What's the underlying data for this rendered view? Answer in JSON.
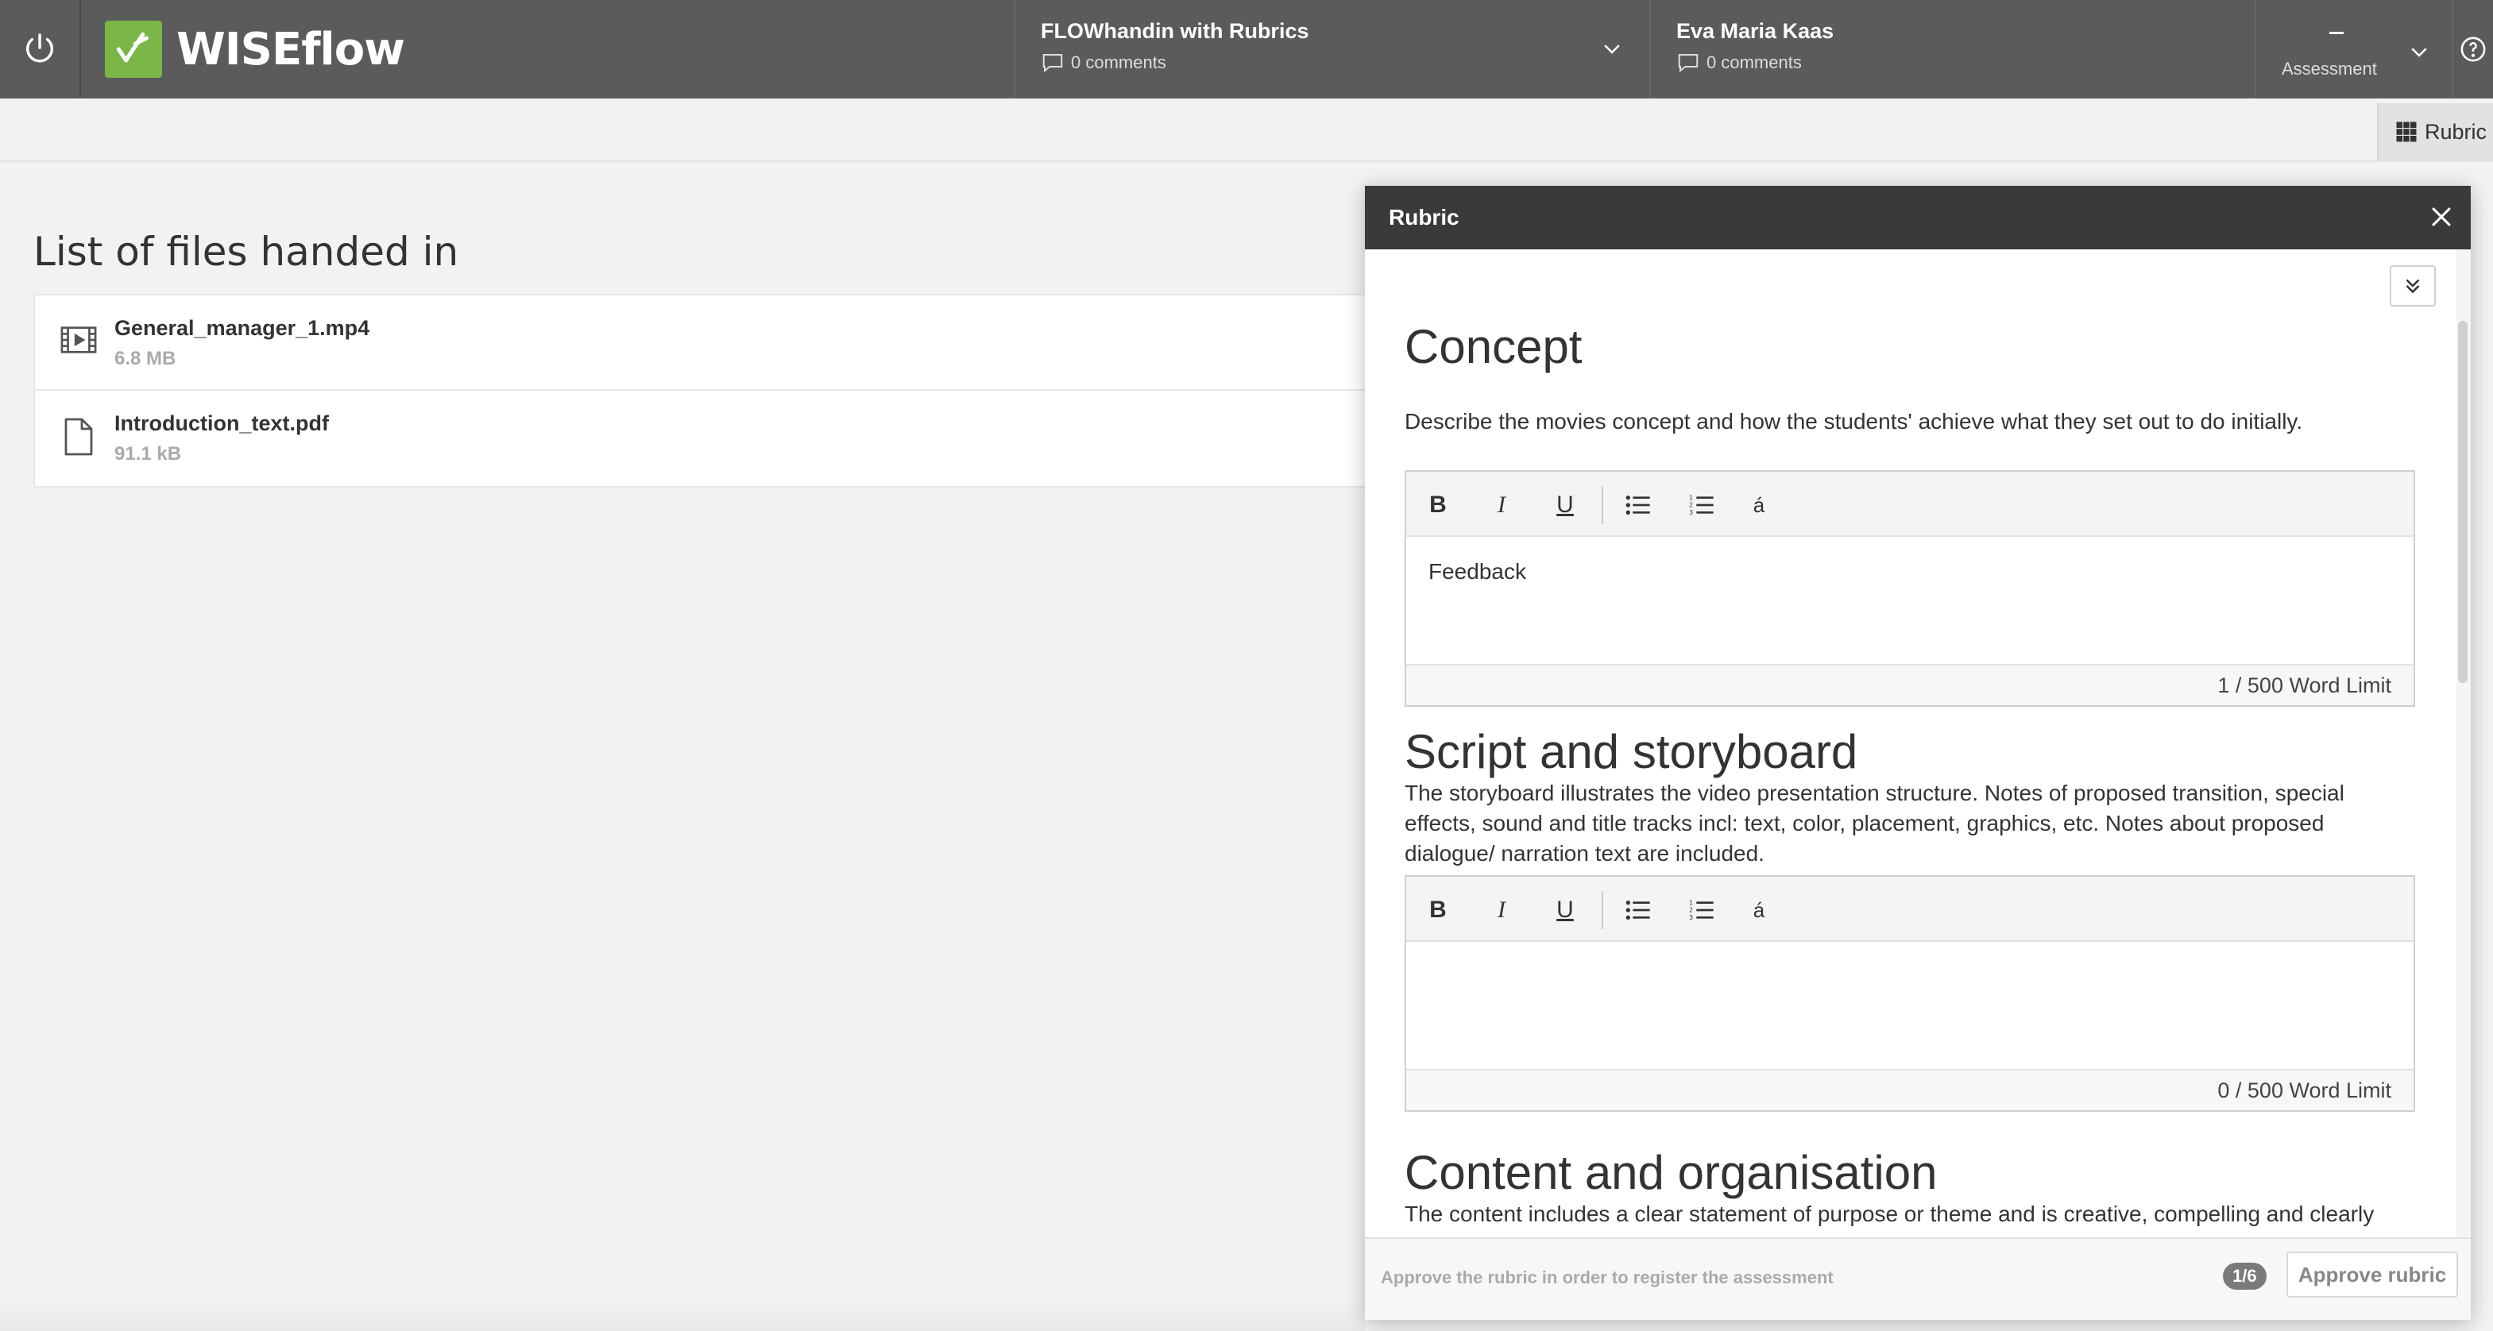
{
  "header": {
    "app_name": "WISEflow",
    "flow": {
      "title": "FLOWhandin with Rubrics",
      "comments": "0 comments"
    },
    "participant": {
      "name": "Eva Maria Kaas",
      "comments": "0 comments"
    },
    "assessment": {
      "value": "–",
      "label": "Assessment"
    },
    "brand_color": "#7ab648"
  },
  "toolbar": {
    "rubric_label": "Rubric"
  },
  "files": {
    "title": "List of files handed in",
    "items": [
      {
        "name": "General_manager_1.mp4",
        "size": "6.8 MB",
        "icon": "video-file-icon"
      },
      {
        "name": "Introduction_text.pdf",
        "size": "91.1 kB",
        "icon": "document-file-icon"
      }
    ]
  },
  "rubric": {
    "title": "Rubric",
    "sections": [
      {
        "title": "Concept",
        "description": "Describe the movies concept and how the students' achieve what they set out to do initially.",
        "content": "Feedback",
        "word_count": "1 / 500 Word Limit"
      },
      {
        "title": "Script and storyboard",
        "description": "The storyboard illustrates the video presentation structure. Notes of proposed transition, special effects, sound and title tracks incl: text, color, placement, graphics, etc. Notes about proposed dialogue/ narration text are included.",
        "content": "",
        "word_count": "0 / 500 Word Limit"
      },
      {
        "title": "Content and organisation",
        "description": "The content includes a clear statement of purpose or theme and is creative, compelling and clearly"
      }
    ],
    "toolbar": {
      "bold": "B",
      "italic": "I",
      "underline": "U",
      "special": "á"
    },
    "footer_text": "Approve the rubric in order to register the assessment",
    "progress": "1/6",
    "approve_label": "Approve rubric"
  }
}
